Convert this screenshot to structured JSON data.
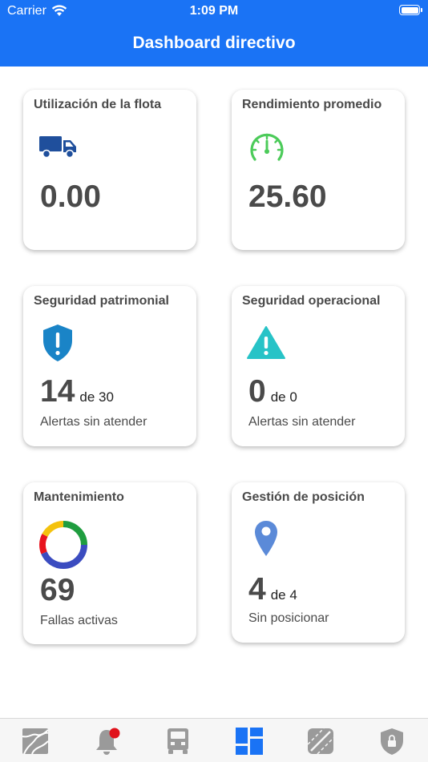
{
  "status_bar": {
    "carrier": "Carrier",
    "time": "1:09 PM"
  },
  "header": {
    "title": "Dashboard directivo",
    "color": "#1a73f5"
  },
  "cards": {
    "fleet": {
      "title": "Utilización de la flota",
      "value": "0.00",
      "icon": "truck-icon"
    },
    "performance": {
      "title": "Rendimiento promedio",
      "value": "25.60",
      "icon": "speedometer-icon"
    },
    "patrimonial": {
      "title": "Seguridad patrimonial",
      "value": "14",
      "of": "de 30",
      "caption": "Alertas sin atender",
      "icon": "shield-alert-icon"
    },
    "operational": {
      "title": "Seguridad operacional",
      "value": "0",
      "of": "de 0",
      "caption": "Alertas sin atender",
      "icon": "warning-icon"
    },
    "maintenance": {
      "title": "Mantenimiento",
      "value": "69",
      "caption": "Fallas activas",
      "icon": "donut-chart-icon"
    },
    "position": {
      "title": "Gestión de posición",
      "value": "4",
      "of": "de 4",
      "caption": "Sin posicionar",
      "icon": "map-pin-icon"
    }
  },
  "tabbar": {
    "tabs": [
      "map-icon",
      "bell-icon",
      "truck-front-icon",
      "dashboard-icon",
      "road-icon",
      "lock-shield-icon"
    ],
    "active": "dashboard-icon",
    "active_color": "#1a73f5",
    "inactive_color": "#9a9a9a",
    "badge_color": "#e0121b"
  }
}
